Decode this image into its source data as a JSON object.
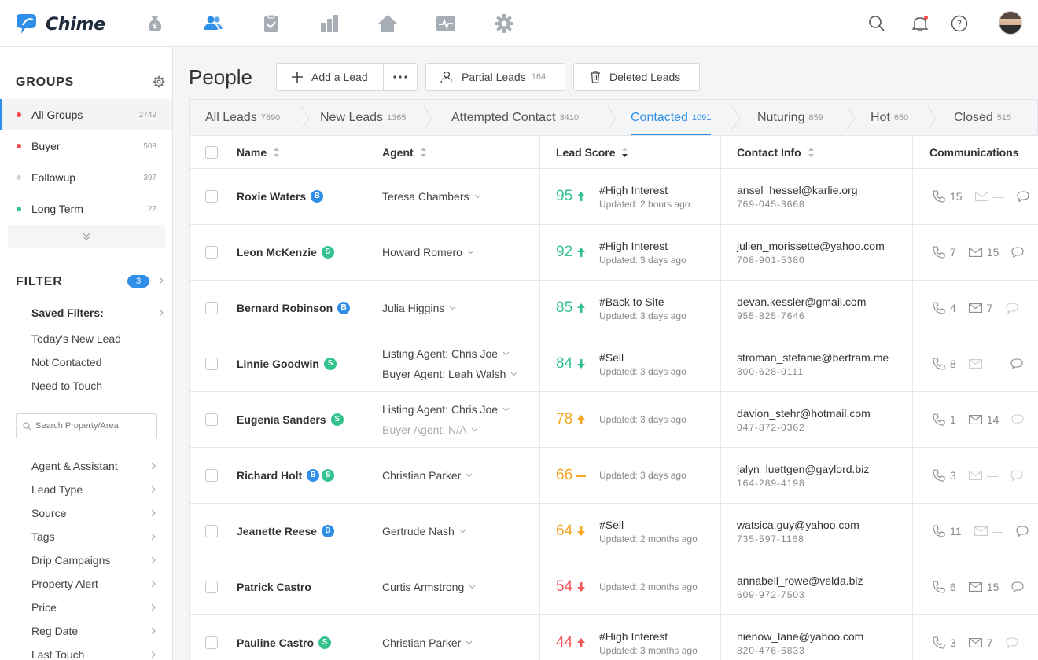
{
  "app": {
    "name": "Chime"
  },
  "colors": {
    "accent": "#2f8fe8",
    "green": "#34c38f",
    "orange": "#f5a623",
    "red": "#f25858"
  },
  "nav_icons": [
    "money-bag-icon",
    "people-icon",
    "clipboard-check-icon",
    "bar-chart-icon",
    "home-icon",
    "activity-icon",
    "gear-icon"
  ],
  "nav_active": "people-icon",
  "right_icons": [
    "search-icon",
    "bell-icon",
    "help-icon",
    "avatar"
  ],
  "sidebar": {
    "groups_title": "GROUPS",
    "groups": [
      {
        "label": "All Groups",
        "count": "2749",
        "color": "#f04b4b",
        "active": true
      },
      {
        "label": "Buyer",
        "count": "508",
        "color": "#f04b4b"
      },
      {
        "label": "Followup",
        "count": "397",
        "color": "#cfd2d6"
      },
      {
        "label": "Long Term",
        "count": "22",
        "color": "#34c38f"
      }
    ],
    "filter_title": "FILTER",
    "filter_count": "3",
    "saved_filters_label": "Saved Filters:",
    "saved_filters": [
      "Today's New Lead",
      "Not Contacted",
      "Need to Touch"
    ],
    "search_placeholder": "Search Property/Area",
    "filters": [
      "Agent & Assistant",
      "Lead Type",
      "Source",
      "Tags",
      "Drip Campaigns",
      "Property Alert",
      "Price",
      "Reg Date",
      "Last Touch"
    ]
  },
  "main": {
    "title": "People",
    "add_lead_label": "Add a Lead",
    "partial_leads_label": "Partial Leads",
    "partial_leads_count": "164",
    "deleted_leads_label": "Deleted Leads",
    "tabs": [
      {
        "label": "All Leads",
        "count": "7890"
      },
      {
        "label": "New Leads",
        "count": "1365"
      },
      {
        "label": "Attempted Contact",
        "count": "3410"
      },
      {
        "label": "Contacted",
        "count": "1091",
        "active": true
      },
      {
        "label": "Nuturing",
        "count": "859"
      },
      {
        "label": "Hot",
        "count": "650"
      },
      {
        "label": "Closed",
        "count": "515"
      }
    ],
    "columns": {
      "name": "Name",
      "agent": "Agent",
      "score": "Lead Score",
      "contact": "Contact Info",
      "comm": "Communications"
    }
  },
  "rows": [
    {
      "name": "Roxie Waters",
      "badges": [
        "B"
      ],
      "agents": [
        "Teresa Chambers"
      ],
      "score": "95",
      "trend": "up",
      "level": "high",
      "tag": "#High Interest",
      "updated": "Updated: 2 hours ago",
      "email": "ansel_hessel@karlie.org",
      "phone": "769-045-3668",
      "calls": "15",
      "emails": "—",
      "emails_dim": true,
      "msg_dim": false
    },
    {
      "name": "Leon McKenzie",
      "badges": [
        "S"
      ],
      "agents": [
        "Howard Romero"
      ],
      "score": "92",
      "trend": "up",
      "level": "high",
      "tag": "#High Interest",
      "updated": "Updated: 3 days ago",
      "email": "julien_morissette@yahoo.com",
      "phone": "708-901-5380",
      "calls": "7",
      "emails": "15",
      "emails_dim": false,
      "msg_dim": false
    },
    {
      "name": "Bernard Robinson",
      "badges": [
        "B"
      ],
      "agents": [
        "Julia Higgins"
      ],
      "score": "85",
      "trend": "up",
      "level": "high",
      "tag": "#Back to Site",
      "updated": "Updated: 3 days ago",
      "email": "devan.kessler@gmail.com",
      "phone": "955-825-7646",
      "calls": "4",
      "emails": "7",
      "emails_dim": false,
      "msg_dim": true
    },
    {
      "name": "Linnie Goodwin",
      "badges": [
        "S"
      ],
      "agents": [
        "Listing Agent: Chris Joe",
        "Buyer Agent: Leah Walsh"
      ],
      "score": "84",
      "trend": "down",
      "level": "high",
      "tag": "#Sell",
      "updated": "Updated: 3 days ago",
      "email": "stroman_stefanie@bertram.me",
      "phone": "300-628-0111",
      "calls": "8",
      "emails": "—",
      "emails_dim": true,
      "msg_dim": false
    },
    {
      "name": "Eugenia Sanders",
      "badges": [
        "S"
      ],
      "agents": [
        "Listing Agent: Chris Joe",
        "Buyer Agent: N/A"
      ],
      "score": "78",
      "trend": "up",
      "level": "mid",
      "tag": "",
      "updated": "Updated: 3 days ago",
      "email": "davion_stehr@hotmail.com",
      "phone": "047-872-0362",
      "calls": "1",
      "emails": "14",
      "emails_dim": false,
      "msg_dim": true
    },
    {
      "name": "Richard Holt",
      "badges": [
        "B",
        "S"
      ],
      "agents": [
        "Christian Parker"
      ],
      "score": "66",
      "trend": "flat",
      "level": "mid",
      "tag": "",
      "updated": "Updated: 3 days ago",
      "email": "jalyn_luettgen@gaylord.biz",
      "phone": "164-289-4198",
      "calls": "3",
      "emails": "—",
      "emails_dim": true,
      "msg_dim": true
    },
    {
      "name": "Jeanette Reese",
      "badges": [
        "B"
      ],
      "agents": [
        "Gertrude Nash"
      ],
      "score": "64",
      "trend": "down",
      "level": "mid",
      "tag": "#Sell",
      "updated": "Updated: 2 months ago",
      "email": "watsica.guy@yahoo.com",
      "phone": "735-597-1168",
      "calls": "11",
      "emails": "—",
      "emails_dim": true,
      "msg_dim": false
    },
    {
      "name": "Patrick Castro",
      "badges": [],
      "agents": [
        "Curtis Armstrong"
      ],
      "score": "54",
      "trend": "down",
      "level": "low",
      "tag": "",
      "updated": "Updated: 2 months ago",
      "email": "annabell_rowe@velda.biz",
      "phone": "609-972-7503",
      "calls": "6",
      "emails": "15",
      "emails_dim": false,
      "msg_dim": false
    },
    {
      "name": "Pauline Castro",
      "badges": [
        "S"
      ],
      "agents": [
        "Christian Parker"
      ],
      "score": "44",
      "trend": "up",
      "level": "low",
      "tag": "#High Interest",
      "updated": "Updated: 3 months ago",
      "email": "nienow_lane@yahoo.com",
      "phone": "820-476-6833",
      "calls": "3",
      "emails": "7",
      "emails_dim": false,
      "msg_dim": true
    }
  ]
}
